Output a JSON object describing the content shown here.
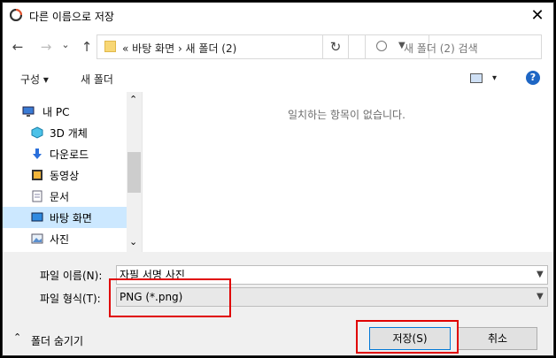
{
  "window": {
    "title": "다른 이름으로 저장",
    "close": "✕"
  },
  "nav": {
    "back": "←",
    "forward": "→",
    "recent": "⌄",
    "up": "↑",
    "breadcrumb": "«  바탕 화면  ›  새 폴더 (2)",
    "refresh": "↻",
    "search_placeholder": "새 폴더 (2) 검색"
  },
  "toolbar": {
    "organize": "구성 ▾",
    "new_folder": "새 폴더",
    "help": "?",
    "view_chev": "▾"
  },
  "tree": [
    {
      "label": "내 PC",
      "icon": "pc-icon"
    },
    {
      "label": "3D 개체",
      "icon": "3d-objects-icon"
    },
    {
      "label": "다운로드",
      "icon": "download-icon"
    },
    {
      "label": "동영상",
      "icon": "video-icon"
    },
    {
      "label": "문서",
      "icon": "document-icon"
    },
    {
      "label": "바탕 화면",
      "icon": "desktop-icon",
      "selected": true
    },
    {
      "label": "사진",
      "icon": "pictures-icon"
    }
  ],
  "main": {
    "empty_message": "일치하는 항목이 없습니다."
  },
  "form": {
    "filename_label": "파일 이름(N):",
    "filename_value": "자필 서명 사진",
    "filetype_label": "파일 형식(T):",
    "filetype_value": "PNG (*.png)",
    "hide_folders": "폴더 숨기기",
    "save": "저장(S)",
    "cancel": "취소"
  },
  "scroll": {
    "up": "⌃",
    "down": "⌄"
  },
  "colors": {
    "highlight": "#e00000",
    "selection": "#cce8ff",
    "accent": "#1e66c4"
  }
}
